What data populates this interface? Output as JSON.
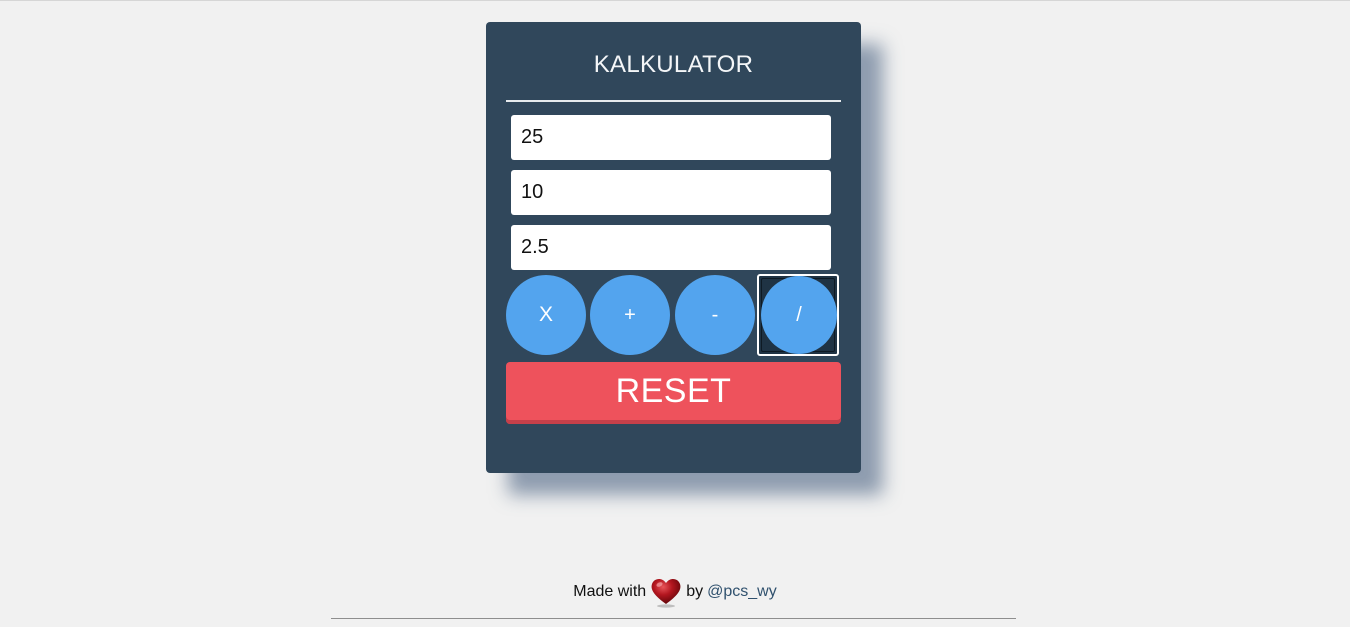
{
  "calculator": {
    "title": "KALKULATOR",
    "inputs": [
      {
        "value": "25"
      },
      {
        "value": "10"
      },
      {
        "value": "2.5"
      }
    ],
    "operations": {
      "multiply": "X",
      "add": "+",
      "subtract": "-",
      "divide": "/"
    },
    "reset_label": "RESET"
  },
  "footer": {
    "made_with": "Made with",
    "by": "by",
    "author": "@pcs_wy",
    "icon": "heart-icon"
  },
  "colors": {
    "background": "#f1f1f1",
    "panel": "#30475b",
    "operation_button": "#53a4ee",
    "reset_button": "#ee525c",
    "link": "#30516e"
  }
}
